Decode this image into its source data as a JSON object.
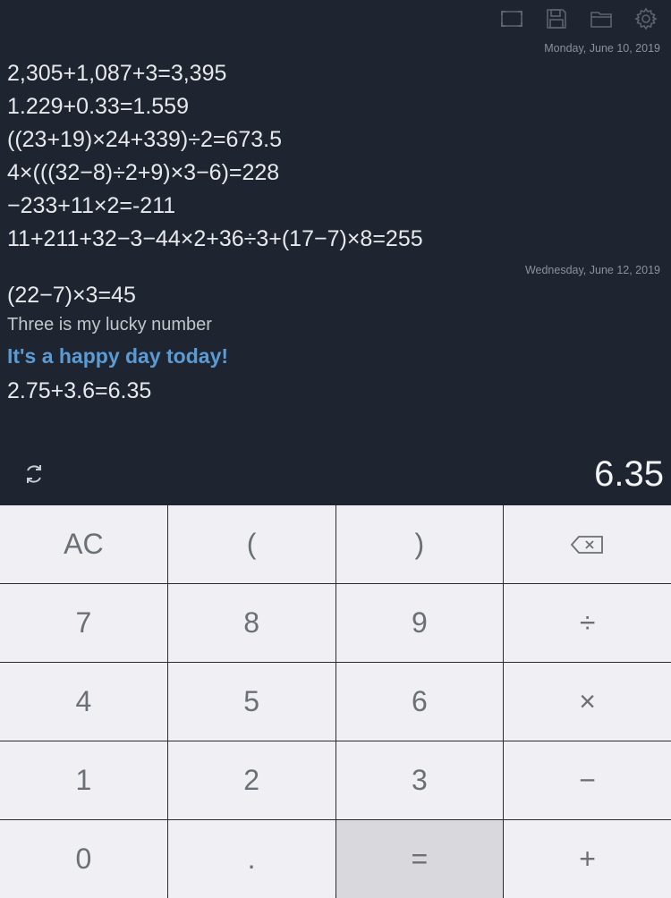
{
  "toolbar": {
    "icons": [
      "fullscreen-icon",
      "save-icon",
      "folder-icon",
      "gear-icon"
    ]
  },
  "history": {
    "group1": {
      "date": "Monday, June 10, 2019",
      "lines": [
        "2,305+1,087+3=3,395",
        "1.229+0.33=1.559",
        "((23+19)×24+339)÷2=673.5",
        "4×(((32−8)÷2+9)×3−6)=228",
        "−233+11×2=-211",
        "11+211+32−3−44×2+36÷3+(17−7)×8=255"
      ]
    },
    "group2": {
      "date": "Wednesday, June 12, 2019",
      "line1": "(22−7)×3=45",
      "note1": "Three is my lucky number",
      "note2": "It's a happy day today!",
      "line2": "2.75+3.6=6.35"
    }
  },
  "display": {
    "result": "6.35"
  },
  "keypad": {
    "ac": "AC",
    "open_paren": "(",
    "close_paren": ")",
    "seven": "7",
    "eight": "8",
    "nine": "9",
    "divide": "÷",
    "four": "4",
    "five": "5",
    "six": "6",
    "multiply": "×",
    "one": "1",
    "two": "2",
    "three": "3",
    "minus": "−",
    "zero": "0",
    "decimal": ".",
    "equals": "=",
    "plus": "+"
  },
  "colors": {
    "background": "#1f2530",
    "highlight_note": "#5b9bd5",
    "key_background": "#efeff4",
    "key_pressed": "#d9d9dd"
  }
}
